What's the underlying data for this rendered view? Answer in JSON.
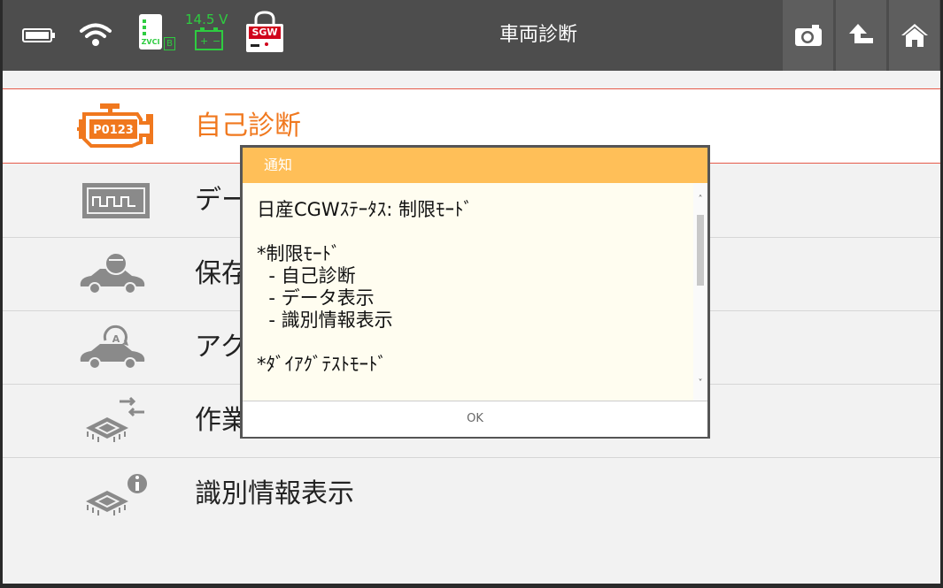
{
  "header": {
    "title": "車両診断",
    "status": {
      "voltage": "14.5 V",
      "vci_label": "ZVCI",
      "vci_badge": "B",
      "sgw_label": "SGW"
    },
    "buttons": [
      "camera-icon",
      "back-arrow-icon",
      "home-icon"
    ]
  },
  "menu": {
    "items": [
      {
        "label": "自己診断",
        "icon": "engine-check-icon",
        "code": "P0123",
        "active": true
      },
      {
        "label": "データ表示",
        "icon": "waveform-icon"
      },
      {
        "label": "保存データ",
        "icon": "car-service-icon"
      },
      {
        "label": "アクティブテスト",
        "icon": "car-active-test-icon"
      },
      {
        "label": "作業サポート",
        "icon": "chip-transfer-icon"
      },
      {
        "label": "識別情報表示",
        "icon": "chip-info-icon"
      }
    ]
  },
  "dialog": {
    "title": "通知",
    "body": "日産CGWｽﾃｰﾀｽ: 制限ﾓｰﾄﾞ\n\n*制限ﾓｰﾄﾞ\n  - 自己診断\n  - データ表示\n  - 識別情報表示\n\n*ﾀﾞｲｱｸﾞﾃｽﾄﾓｰﾄﾞ",
    "ok_label": "OK"
  },
  "colors": {
    "accent": "#f0781e",
    "header_bg": "#4d4d4d",
    "dialog_header": "#ffbf58",
    "voltage_green": "#2ecc40",
    "sgw_red": "#d0021b"
  }
}
